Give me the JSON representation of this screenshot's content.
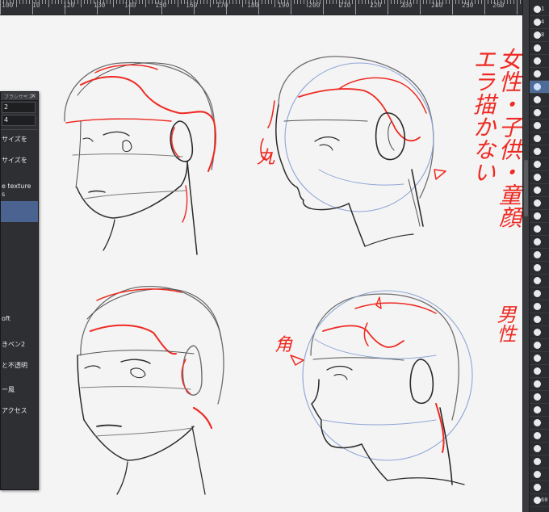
{
  "ruler": {
    "labels": [
      "100",
      "10",
      "120",
      "130",
      "140",
      "150",
      "160",
      "170",
      "180",
      "190",
      "200",
      "210",
      "220",
      "230",
      "240",
      "250",
      "260"
    ]
  },
  "palette": {
    "pencil": "#2b2b2b",
    "red": "#ee2a22",
    "blue": "#8fa6d6",
    "ui_dark": "#2e2f32",
    "ui_select": "#4a6390"
  },
  "canvas_notes": {
    "female_note": "女性・子供・童顔 エラ描かない",
    "female_mark_left": "丸",
    "male_note": "男性",
    "male_mark_left": "角"
  },
  "tool_panel": {
    "title": "ブラシサイズ",
    "value_1": "2",
    "value_2": "4",
    "items": [
      "サイズを",
      "サイズを",
      "e texture",
      "s",
      "oft",
      "きペン2",
      "と不透明",
      "ー風",
      "アクセス"
    ]
  },
  "layers": {
    "numbers": [
      "1",
      "4",
      "8",
      "",
      "",
      "",
      "",
      "",
      "",
      "",
      "",
      "",
      "",
      "",
      "",
      "",
      "",
      "",
      "",
      "",
      "",
      "",
      "",
      "",
      "",
      "",
      "",
      "",
      "",
      "",
      "",
      "",
      "",
      "",
      "",
      "",
      "",
      "",
      "60"
    ]
  }
}
